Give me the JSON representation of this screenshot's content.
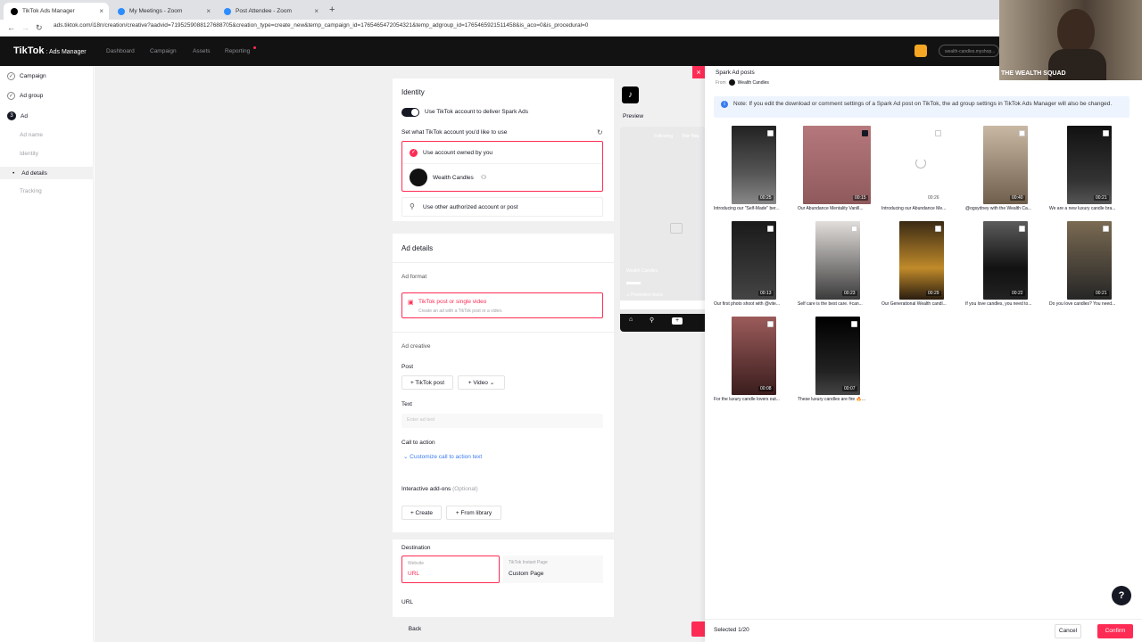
{
  "browser": {
    "tabs": [
      {
        "title": "TikTok Ads Manager",
        "color": "#000000"
      },
      {
        "title": "My Meetings - Zoom",
        "color": "#2d8cff"
      },
      {
        "title": "Post Attendee - Zoom",
        "color": "#2d8cff"
      }
    ],
    "url": "ads.tiktok.com/i18n/creation/creative?aadvid=7195259088127688705&creation_type=create_new&temp_campaign_id=1765465472054321&temp_adgroup_id=1765465921511458&is_aco=0&is_procedural=0"
  },
  "topnav": {
    "brand": "TikTok",
    "brand_sub": ": Ads Manager",
    "items": [
      "Dashboard",
      "Campaign",
      "Assets",
      "Reporting"
    ],
    "account": "wealth-candles.myshop..."
  },
  "leftnav": {
    "campaign": "Campaign",
    "adgroup": "Ad group",
    "ad_num": "3",
    "ad": "Ad",
    "ad_name": "Ad name",
    "identity": "Identity",
    "ad_details": "Ad details",
    "tracking": "Tracking"
  },
  "identity": {
    "title": "Identity",
    "toggle_label": "Use TikTok account to deliver Spark Ads",
    "set_account": "Set what TikTok account you'd like to use",
    "owned": "Use account owned by you",
    "account_name": "Wealth Candles",
    "other": "Use other authorized account or post"
  },
  "preview": {
    "label": "Preview",
    "following": "Following",
    "for_you": "For You",
    "account": "Wealth Candles",
    "music": "♫ Promoted music"
  },
  "ad_details": {
    "title": "Ad details",
    "format_label": "Ad format",
    "format_title": "TikTok post or single video",
    "format_sub": "Create an ad with a TikTok post or a video.",
    "creative_label": "Ad creative",
    "post_label": "Post",
    "tiktok_post": "+ TikTok post",
    "video": "+ Video",
    "text_label": "Text",
    "text_placeholder": "Enter ad text",
    "cta_label": "Call to action",
    "cta_link": "Customize call to action text",
    "addons_label": "Interactive add-ons",
    "optional": "(Optional)",
    "create": "+ Create",
    "from_library": "+ From library",
    "destination": "Destination",
    "website": "Website",
    "url_opt": "URL",
    "instant_page": "TikTok Instant Page",
    "custom_page": "Custom Page",
    "url_label": "URL",
    "back": "Back"
  },
  "spark": {
    "title": "Spark Ad posts",
    "from": "From",
    "from_account": "Wealth Candles",
    "note": "Note: If you edit the download or comment settings of a Spark Ad post on TikTok, the ad group settings in TikTok Ads Manager will also be changed.",
    "posts": [
      {
        "duration": "00:25",
        "caption": "Introducing our \"Self-Made\" ber...",
        "checked": false
      },
      {
        "duration": "00:15",
        "caption": "Our Abundance Mentality Vanill...",
        "checked": true
      },
      {
        "duration": "00:26",
        "caption": "Introducing our Abundance Me...",
        "checked": false
      },
      {
        "duration": "00:40",
        "caption": "@ogsydney with the Wealth Ca...",
        "checked": false
      },
      {
        "duration": "00:21",
        "caption": "We are a new luxury candle bra...",
        "checked": false
      },
      {
        "duration": "00:13",
        "caption": "Our first photo shoot with @vite...",
        "checked": false
      },
      {
        "duration": "00:23",
        "caption": "Self care is the best care. #can...",
        "checked": false
      },
      {
        "duration": "00:29",
        "caption": "Our Generational Wealth candl...",
        "checked": false
      },
      {
        "duration": "00:22",
        "caption": "If you love candles, you need to...",
        "checked": false
      },
      {
        "duration": "00:21",
        "caption": "Do you love candles? You need...",
        "checked": false
      },
      {
        "duration": "00:08",
        "caption": "For the luxury candle lovers out...",
        "checked": false
      },
      {
        "duration": "00:07",
        "caption": "These luxury candles are fire 🔥...",
        "checked": false
      }
    ],
    "selected": "Selected 1/20",
    "cancel": "Cancel",
    "confirm": "Confirm"
  },
  "webcam": {
    "label": "THE WEALTH SQUAD"
  },
  "colors": {
    "accent": "#fe2c55",
    "dark": "#121212"
  }
}
